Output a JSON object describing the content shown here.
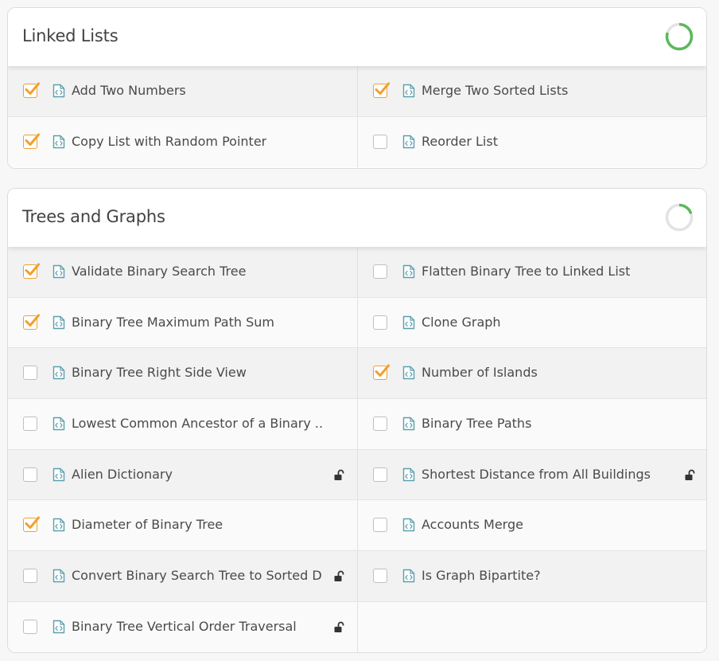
{
  "sections": [
    {
      "title": "Linked Lists",
      "progress": 0.8,
      "items": [
        {
          "label": "Add Two Numbers",
          "checked": true,
          "locked": false
        },
        {
          "label": "Merge Two Sorted Lists",
          "checked": true,
          "locked": false
        },
        {
          "label": "Copy List with Random Pointer",
          "checked": true,
          "locked": false
        },
        {
          "label": "Reorder List",
          "checked": false,
          "locked": false
        }
      ]
    },
    {
      "title": "Trees and Graphs",
      "progress": 0.2,
      "items": [
        {
          "label": "Validate Binary Search Tree",
          "checked": true,
          "locked": false
        },
        {
          "label": "Flatten Binary Tree to Linked List",
          "checked": false,
          "locked": false
        },
        {
          "label": "Binary Tree Maximum Path Sum",
          "checked": true,
          "locked": false
        },
        {
          "label": "Clone Graph",
          "checked": false,
          "locked": false
        },
        {
          "label": "Binary Tree Right Side View",
          "checked": false,
          "locked": false
        },
        {
          "label": "Number of Islands",
          "checked": true,
          "locked": false
        },
        {
          "label": "Lowest Common Ancestor of a Binary ...",
          "checked": false,
          "locked": false
        },
        {
          "label": "Binary Tree Paths",
          "checked": false,
          "locked": false
        },
        {
          "label": "Alien Dictionary",
          "checked": false,
          "locked": true
        },
        {
          "label": "Shortest Distance from All Buildings",
          "checked": false,
          "locked": true
        },
        {
          "label": "Diameter of Binary Tree",
          "checked": true,
          "locked": false
        },
        {
          "label": "Accounts Merge",
          "checked": false,
          "locked": false
        },
        {
          "label": "Convert Binary Search Tree to Sorted D...",
          "checked": false,
          "locked": true
        },
        {
          "label": "Is Graph Bipartite?",
          "checked": false,
          "locked": false
        },
        {
          "label": "Binary Tree Vertical Order Traversal",
          "checked": false,
          "locked": true
        }
      ]
    }
  ],
  "icons": {
    "item": "code-file-icon",
    "locked": "unlocked-padlock-icon",
    "checkbox": "checkmark-icon"
  },
  "colors": {
    "progress": "#5cb85c",
    "progress_track": "#e3e3e3",
    "check": "#f0a030",
    "file_icon": "#5a9fad"
  }
}
